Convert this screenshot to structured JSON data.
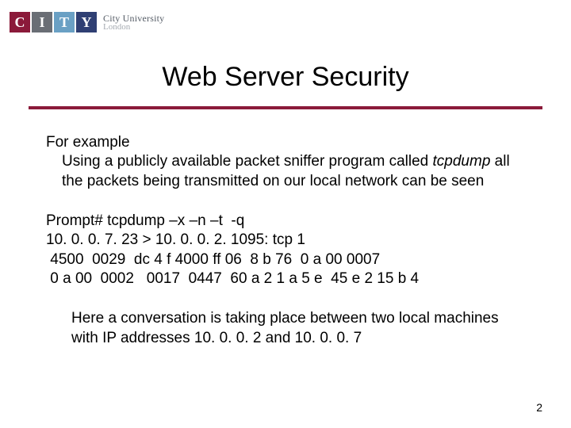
{
  "logo": {
    "letters": [
      "C",
      "I",
      "T",
      "Y"
    ],
    "line1": "City University",
    "line2": "London"
  },
  "title": "Web Server Security",
  "para1_lead": "For example",
  "para1_body_a": "Using a publicly available packet sniffer program called ",
  "para1_body_em": "tcpdump",
  "para1_body_b": " all the packets being transmitted on our local network can be seen",
  "term": {
    "l1": "Prompt# tcpdump –x –n –t  -q",
    "l2": "10. 0. 0. 7. 23 > 10. 0. 0. 2. 1095: tcp 1",
    "l3": " 4500  0029  dc 4 f 4000 ff 06  8 b 76  0 a 00 0007",
    "l4": " 0 a 00  0002   0017  0447  60 a 2 1 a 5 e  45 e 2 15 b 4"
  },
  "para2": "Here a conversation is taking place between two local machines with IP addresses 10. 0. 0. 2 and 10. 0. 0. 7",
  "page_number": "2"
}
